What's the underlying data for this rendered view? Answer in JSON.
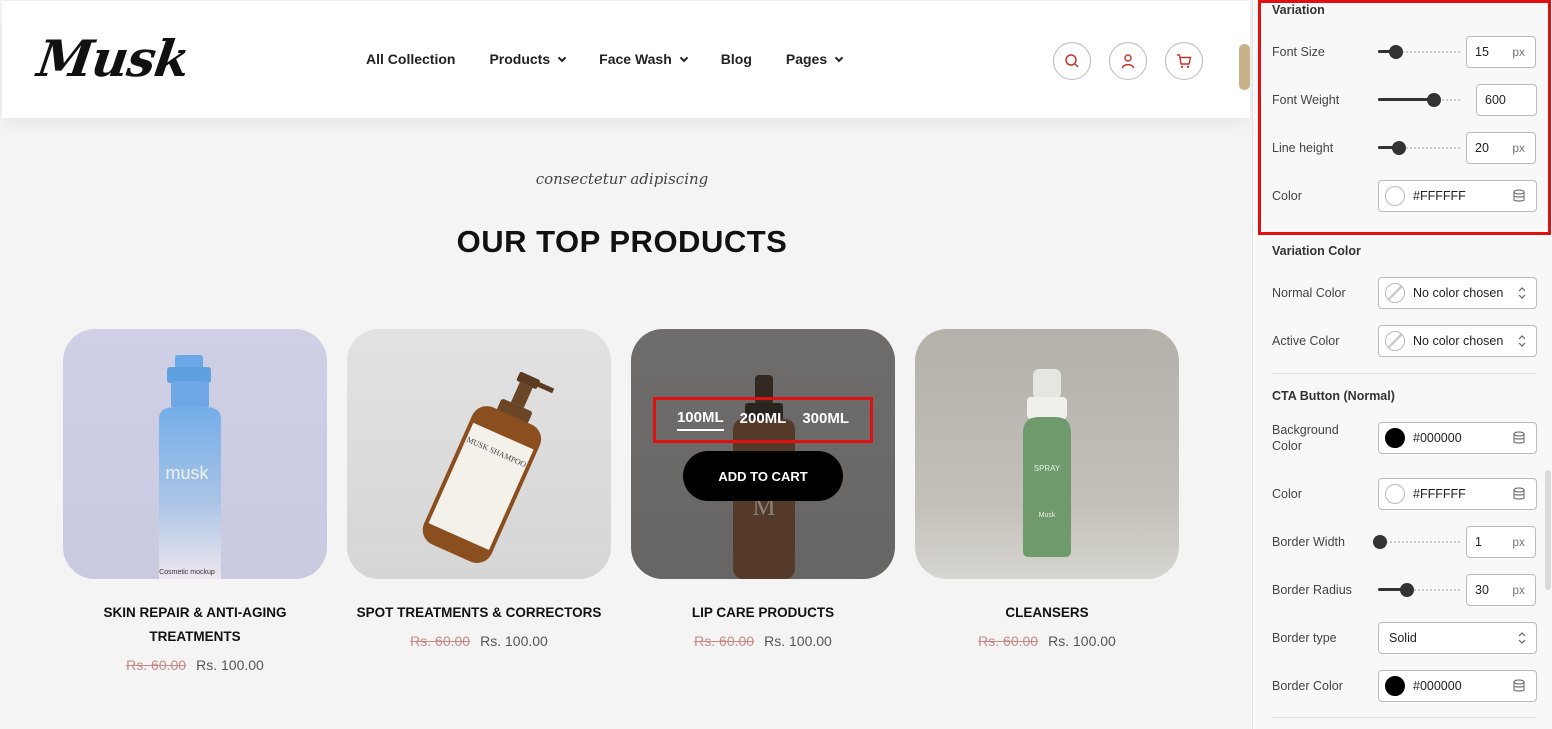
{
  "header": {
    "logo": "Musk",
    "nav": [
      {
        "label": "All Collection",
        "has_dropdown": false
      },
      {
        "label": "Products",
        "has_dropdown": true
      },
      {
        "label": "Face Wash",
        "has_dropdown": true
      },
      {
        "label": "Blog",
        "has_dropdown": false
      },
      {
        "label": "Pages",
        "has_dropdown": true
      }
    ],
    "icons": [
      "search-icon",
      "user-icon",
      "cart-icon"
    ],
    "accent_color": "#c0392b"
  },
  "section": {
    "subtitle": "consectetur adipiscing",
    "heading": "OUR TOP PRODUCTS"
  },
  "products": [
    {
      "title": "SKIN REPAIR & ANTI-AGING TREATMENTS",
      "old_price": "Rs. 60.00",
      "price": "Rs. 100.00",
      "label_text": "musk",
      "label_sub": "Cosmetic mockup"
    },
    {
      "title": "SPOT TREATMENTS & CORRECTORS",
      "old_price": "Rs. 60.00",
      "price": "Rs. 100.00",
      "label_text": "MUSK SHAMPOO"
    },
    {
      "title": "LIP CARE PRODUCTS",
      "old_price": "Rs. 60.00",
      "price": "Rs. 100.00",
      "variations": [
        "100ML",
        "200ML",
        "300ML"
      ],
      "active_variation": "100ML",
      "cta": "ADD TO CART",
      "label_text": "M"
    },
    {
      "title": "CLEANSERS",
      "old_price": "Rs. 60.00",
      "price": "Rs. 100.00",
      "label_text": "SPRAY",
      "label_sub": "Musk"
    }
  ],
  "panel": {
    "variation": {
      "title": "Variation",
      "font_size": {
        "label": "Font Size",
        "value": "15",
        "unit": "px",
        "level": 0.22
      },
      "font_weight": {
        "label": "Font Weight",
        "value": "600",
        "level": 0.68
      },
      "line_height": {
        "label": "Line height",
        "value": "20",
        "unit": "px",
        "level": 0.25
      },
      "color": {
        "label": "Color",
        "value": "#FFFFFF"
      }
    },
    "variation_color": {
      "title": "Variation Color",
      "normal": {
        "label": "Normal Color",
        "value": "No color chosen"
      },
      "active": {
        "label": "Active Color",
        "value": "No color chosen"
      }
    },
    "cta": {
      "title": "CTA Button (Normal)",
      "background": {
        "label": "Background Color",
        "value": "#000000"
      },
      "color": {
        "label": "Color",
        "value": "#FFFFFF"
      },
      "border_width": {
        "label": "Border Width",
        "value": "1",
        "unit": "px",
        "level": 0.02
      },
      "border_radius": {
        "label": "Border Radius",
        "value": "30",
        "unit": "px",
        "level": 0.35
      },
      "border_type": {
        "label": "Border type",
        "value": "Solid"
      },
      "border_color": {
        "label": "Border Color",
        "value": "#000000"
      }
    }
  }
}
